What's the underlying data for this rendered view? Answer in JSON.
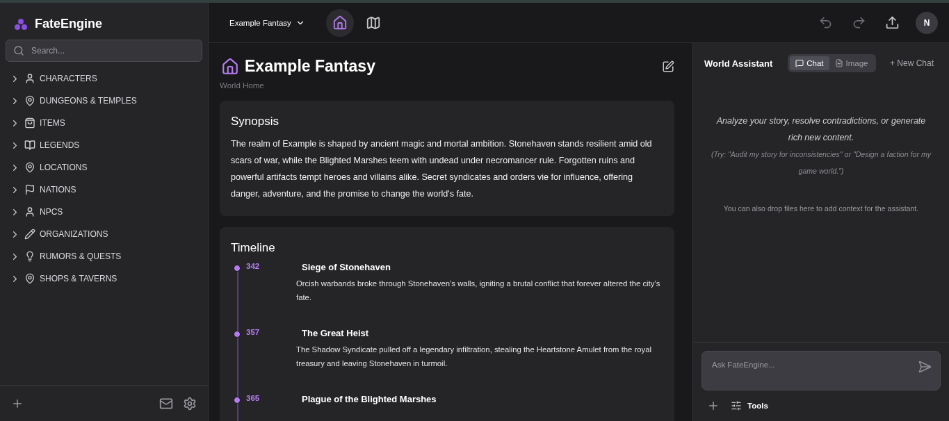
{
  "app": {
    "name": "FateEngine"
  },
  "search": {
    "placeholder": "Search..."
  },
  "sidebar": {
    "items": [
      {
        "label": "CHARACTERS",
        "expanded": false
      },
      {
        "label": "DUNGEONS & TEMPLES",
        "expanded": false
      },
      {
        "label": "ITEMS",
        "expanded": false
      },
      {
        "label": "LEGENDS",
        "expanded": false
      },
      {
        "label": "LOCATIONS",
        "expanded": false
      },
      {
        "label": "NATIONS",
        "expanded": false
      },
      {
        "label": "NPCS",
        "expanded": false
      },
      {
        "label": "ORGANIZATIONS",
        "expanded": false
      },
      {
        "label": "RUMORS & QUESTS",
        "expanded": false
      },
      {
        "label": "SHOPS & TAVERNS",
        "expanded": false
      }
    ]
  },
  "topbar": {
    "world": "Example Fantasy",
    "views": [
      {
        "kind": "home",
        "selected": true
      },
      {
        "kind": "map",
        "selected": false
      }
    ],
    "actions": [
      {
        "kind": "undo",
        "disabled": true
      },
      {
        "kind": "redo",
        "disabled": true
      },
      {
        "kind": "share",
        "disabled": false
      }
    ],
    "avatar": "N"
  },
  "page": {
    "title": "Example Fantasy",
    "subtitle": "World Home",
    "synopsis": {
      "heading": "Synopsis",
      "text": "The realm of Example is shaped by ancient magic and mortal ambition. Stonehaven stands resilient amid old scars of war, while the Blighted Marshes teem with undead under necromancer rule. Forgotten ruins and powerful artifacts tempt heroes and villains alike. Secret syndicates and orders vie for influence, offering danger, adventure, and the promise to change the world's fate."
    },
    "timeline": {
      "heading": "Timeline",
      "events": [
        {
          "year": "342",
          "title": "Siege of Stonehaven",
          "text": "Orcish warbands broke through Stonehaven’s walls, igniting a brutal conflict that forever altered the city’s fate."
        },
        {
          "year": "357",
          "title": "The Great Heist",
          "text": "The Shadow Syndicate pulled off a legendary infiltration, stealing the Heartstone Amulet from the royal treasury and leaving Stonehaven in turmoil."
        },
        {
          "year": "365",
          "title": "Plague of the Blighted Marshes"
        }
      ]
    }
  },
  "assistant": {
    "title": "World Assistant",
    "tabs": [
      {
        "label": "Chat",
        "selected": true
      },
      {
        "label": "Image",
        "selected": false
      }
    ],
    "new_chat": "+ New Chat",
    "intro": "Analyze your story, resolve contradictions, or generate rich new content.",
    "hint": "(Try: \"Audit my story for inconsistencies\" or \"Design a faction for my game world.\")",
    "drop_note": "You can also drop files here to add context for the assistant.",
    "input": {
      "placeholder": "Ask FateEngine..."
    },
    "tools": "Tools"
  }
}
